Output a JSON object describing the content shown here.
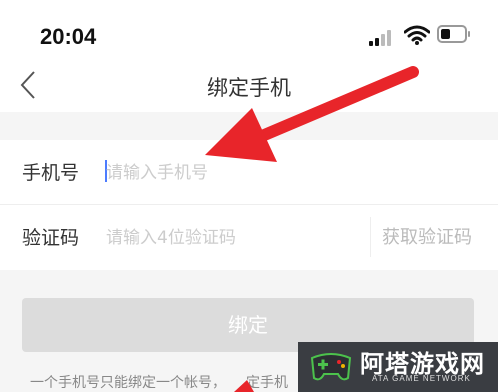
{
  "status_bar": {
    "time": "20:04",
    "signal_icon": "cellular-signal-icon",
    "wifi_icon": "wifi-icon",
    "battery_icon": "battery-icon"
  },
  "nav": {
    "back_icon": "chevron-left-icon",
    "title": "绑定手机"
  },
  "form": {
    "phone": {
      "label": "手机号",
      "placeholder": "请输入手机号"
    },
    "code": {
      "label": "验证码",
      "placeholder": "请输入4位验证码",
      "get_code_label": "获取验证码"
    }
  },
  "bind_button_label": "绑定",
  "hint_text": "一个手机号只能绑定一个帐号，",
  "hint_text_tail": "定手机",
  "watermark": {
    "title": "阿塔游戏网",
    "subtitle": "ATA GAME NETWORK"
  },
  "colors": {
    "accent": "#4d7cfe",
    "arrow": "#e8252a",
    "page_bg": "#f5f5f5",
    "button_disabled": "#dcdcdc"
  }
}
